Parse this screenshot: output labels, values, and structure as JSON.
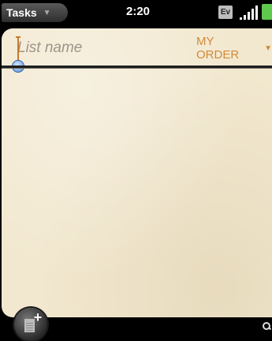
{
  "status_bar": {
    "app_name": "Tasks",
    "time": "2:20",
    "network_badge": "Ev",
    "battery_color": "#5fc94d"
  },
  "list_editor": {
    "name_placeholder": "List name",
    "name_value": "",
    "sort_label": "MY ORDER",
    "accent_color": "#d08a3a",
    "paper_color": "#f2e8cf"
  },
  "icons": {
    "add": "add-item-icon",
    "search": "search-icon"
  }
}
